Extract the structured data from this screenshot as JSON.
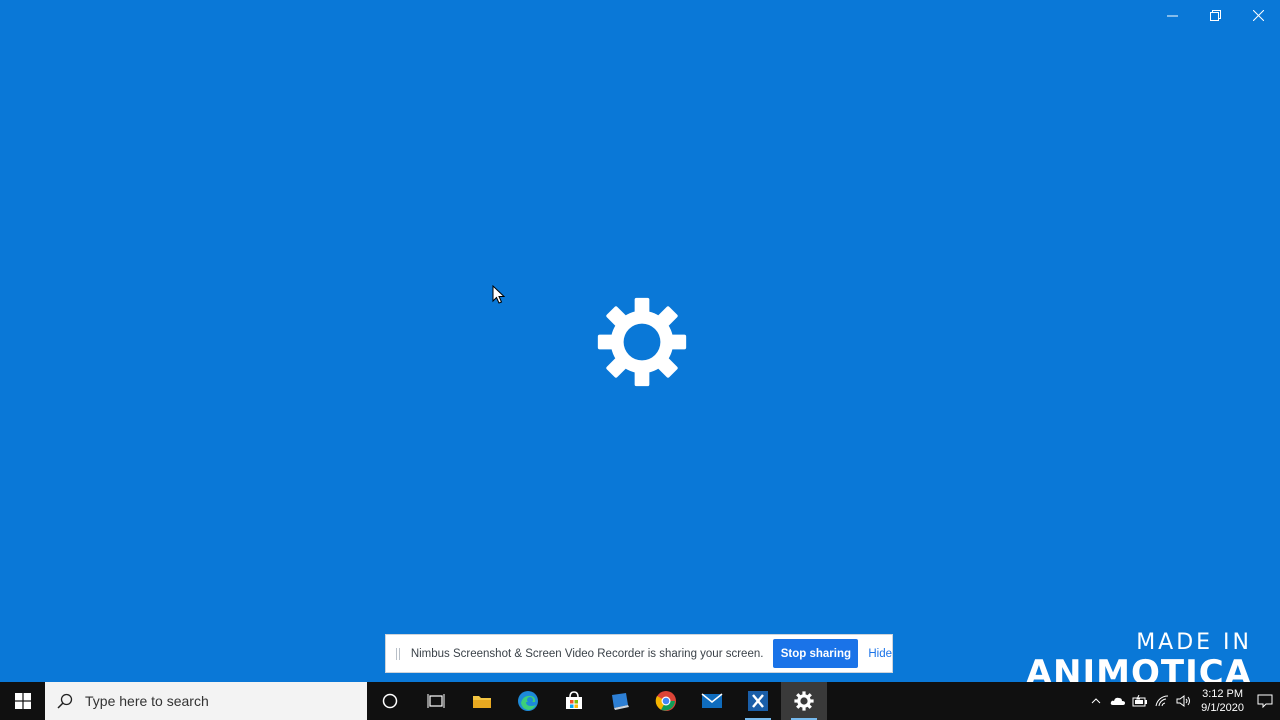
{
  "window": {
    "controls": [
      "minimize",
      "restore",
      "close"
    ]
  },
  "splash": {
    "icon": "gear-icon"
  },
  "share_bar": {
    "message": "Nimbus Screenshot & Screen Video Recorder is sharing your screen.",
    "stop_label": "Stop sharing",
    "hide_label": "Hide"
  },
  "watermark": {
    "line1": "MADE IN",
    "line2": "ANIMOTICA"
  },
  "taskbar": {
    "search_placeholder": "Type here to search",
    "apps": [
      "cortana-icon",
      "task-view-icon",
      "file-explorer-icon",
      "edge-icon",
      "store-icon",
      "app-icon",
      "chrome-icon",
      "mail-icon",
      "xampp-icon",
      "settings-icon"
    ],
    "clock_time": "3:12 PM",
    "clock_date": "9/1/2020"
  },
  "colors": {
    "desktop": "#0a78d7",
    "taskbar": "#101010",
    "accent": "#1a73e8"
  }
}
